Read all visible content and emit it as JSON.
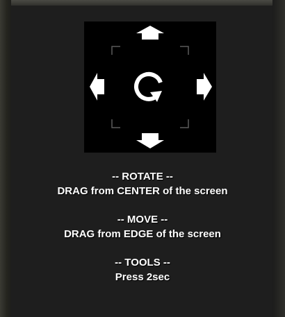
{
  "tutorial": {
    "icons": {
      "up": "arrow-up-icon",
      "down": "arrow-down-icon",
      "left": "arrow-left-icon",
      "right": "arrow-right-icon",
      "center": "rotate-icon",
      "frame": "corner-brackets-icon"
    },
    "colors": {
      "background": "#1e1e1e",
      "diagram_background": "#000000",
      "arrow": "#ffffff",
      "bracket": "#555555",
      "text": "#ffffff"
    },
    "sections": [
      {
        "heading": "-- ROTATE --",
        "body": "DRAG from CENTER of the screen"
      },
      {
        "heading": "-- MOVE --",
        "body": "DRAG from EDGE of the screen"
      },
      {
        "heading": "-- TOOLS --",
        "body": "Press 2sec"
      }
    ]
  }
}
